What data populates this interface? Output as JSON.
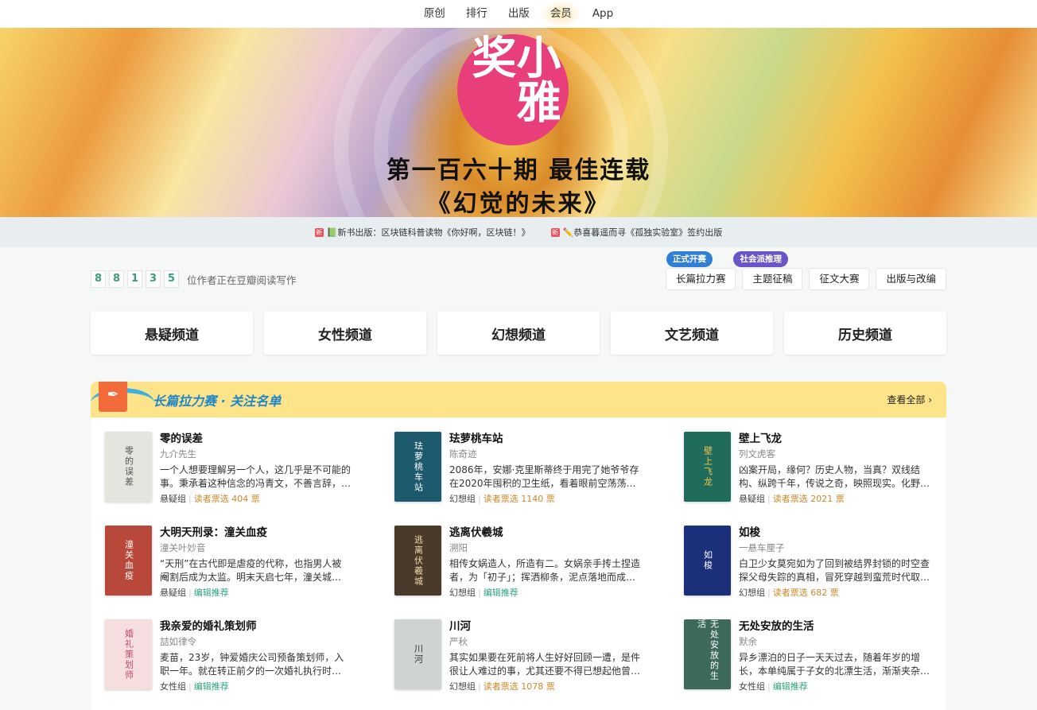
{
  "nav": {
    "items": [
      "原创",
      "排行",
      "出版",
      "会员",
      "App"
    ]
  },
  "hero": {
    "seal_text": "小雅奖",
    "line1": "第一百六十期  最佳连载",
    "line2": "《幻觉的未来》"
  },
  "notices": [
    {
      "new_icon": "新",
      "text": "📗新书出版：区块链科普读物《你好啊，区块链！》"
    },
    {
      "new_icon": "新",
      "text": "✏️恭喜暮遥而寻《孤独实验室》签约出版"
    }
  ],
  "stats": {
    "digits": [
      "8",
      "8",
      "1",
      "3",
      "5"
    ],
    "text": "位作者正在豆瓣阅读写作"
  },
  "right_buttons": [
    {
      "label": "长篇拉力赛",
      "badge": "正式开赛"
    },
    {
      "label": "主题征稿",
      "badge": "社会派推理"
    },
    {
      "label": "征文大赛",
      "badge": ""
    },
    {
      "label": "出版与改编",
      "badge": ""
    }
  ],
  "channels": [
    "悬疑频道",
    "女性频道",
    "幻想频道",
    "文艺频道",
    "历史频道"
  ],
  "panel": {
    "icon": "pen-icon",
    "title": "长篇拉力赛 · 关注名单",
    "more": "查看全部 ›",
    "books": [
      {
        "title": "零的误差",
        "author": "九介先生",
        "desc": "一个人想要理解另一个人，这几乎是不可能的事。秉承着这种信念的冯青文，不善言辞，…",
        "group": "悬疑组",
        "tag": "读者票选 404 票",
        "tag_type": "votes",
        "cover_text": "零的误差",
        "cover_bg": "#e6e4df",
        "cover_fg": "#555"
      },
      {
        "title": "珐萝桃车站",
        "author": "陈奇迹",
        "desc": "2086年，安娜·克里斯蒂终于用完了她爷爷存在2020年囤积的卫生纸，看着眼前空荡荡的柜…",
        "group": "幻想组",
        "tag": "读者票选 1140 票",
        "tag_type": "votes",
        "cover_text": "珐萝桃车站",
        "cover_bg": "#1e5a6e",
        "cover_fg": "#fff"
      },
      {
        "title": "壁上飞龙",
        "author": "列文虎客",
        "desc": "凶案开局，缘何？历史人物，当真？双线结构、纵跨千年，传说之奇，映照现实。化野…",
        "group": "悬疑组",
        "tag": "读者票选 2021 票",
        "tag_type": "votes",
        "cover_text": "壁上飞龙",
        "cover_bg": "#1f6b5c",
        "cover_fg": "#f5c64a"
      },
      {
        "title": "大明天刑录：潼关血疫",
        "author": "潼关叶妙音",
        "desc": "“天刑”在古代即是虐疫的代称，也指男人被阉割后成为太监。明末天启七年，潼关城发生离…",
        "group": "悬疑组",
        "tag": "编辑推荐",
        "tag_type": "rec",
        "cover_text": "潼关血疫",
        "cover_bg": "#b7483a",
        "cover_fg": "#fff"
      },
      {
        "title": "逃离伏羲城",
        "author": "溯阳",
        "desc": "相传女娲造人，所造有二。女娲亲手抟土捏造者，为「初子」；挥洒柳条，泥点落地而成…",
        "group": "幻想组",
        "tag": "编辑推荐",
        "tag_type": "rec",
        "cover_text": "逃离伏羲城",
        "cover_bg": "#4a3a2a",
        "cover_fg": "#f0d9a8"
      },
      {
        "title": "如梭",
        "author": "一悬车厘子",
        "desc": "白卫少女莫宛如为了回到被结界封锁的时空查探父母失踪的真相，冒死穿越到蛮荒时代取…",
        "group": "幻想组",
        "tag": "读者票选 682 票",
        "tag_type": "votes",
        "cover_text": "如梭",
        "cover_bg": "#1b2f7a",
        "cover_fg": "#fff"
      },
      {
        "title": "我亲爱的婚礼策划师",
        "author": "喆如律令",
        "desc": "麦苗，23岁，钟爱婚庆公司预备策划师，入职一年。就在转正前夕的一次婚礼执行时，她…",
        "group": "女性组",
        "tag": "编辑推荐",
        "tag_type": "rec",
        "cover_text": "婚礼策划师",
        "cover_bg": "#f7dede",
        "cover_fg": "#c24a6a"
      },
      {
        "title": "川河",
        "author": "严秋",
        "desc": "其实如果要在死前将人生好好回顾一遭，是件很让人难过的事，尤其还要不得已想起他曾…",
        "group": "幻想组",
        "tag": "读者票选 1078 票",
        "tag_type": "votes",
        "cover_text": "川河",
        "cover_bg": "#cfd3d1",
        "cover_fg": "#333"
      },
      {
        "title": "无处安放的生活",
        "author": "默余",
        "desc": "异乡漂泊的日子一天天过去，随着年岁的增长，本单纯属于子女的北漂生活，渐渐夹杂…",
        "group": "女性组",
        "tag": "编辑推荐",
        "tag_type": "rec",
        "cover_text": "无处安放的生活",
        "cover_bg": "#3e6a5e",
        "cover_fg": "#fff"
      }
    ]
  }
}
